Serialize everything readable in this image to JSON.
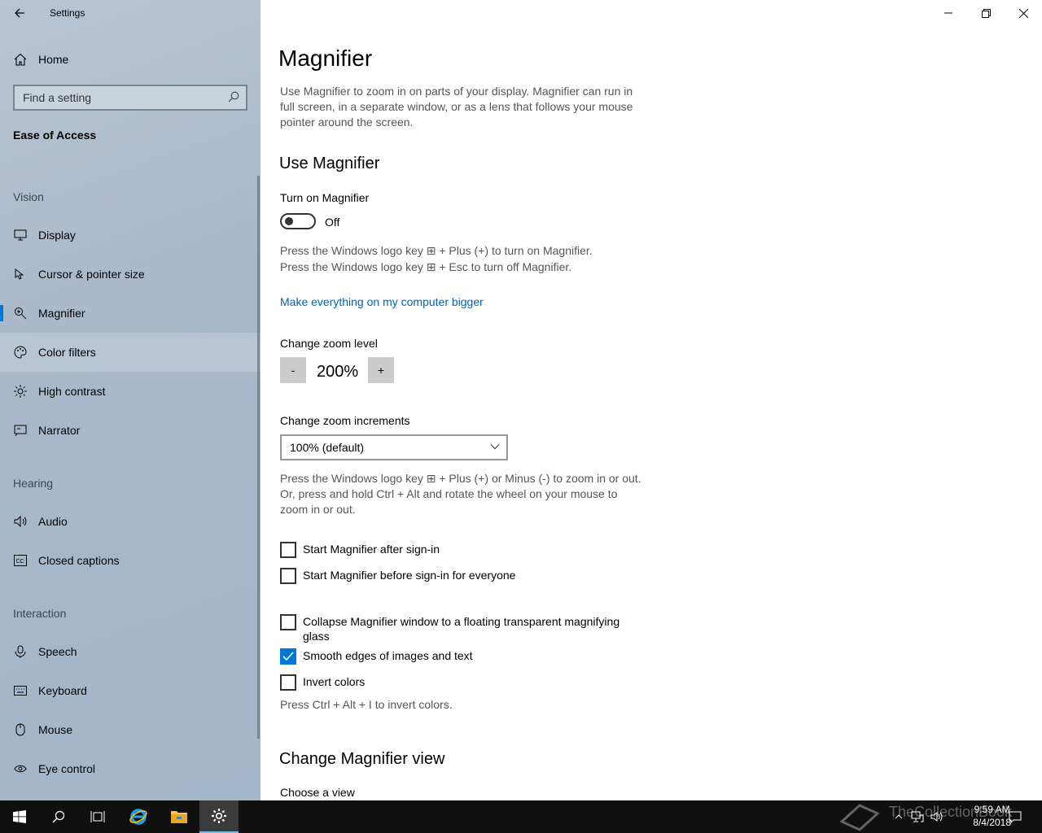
{
  "window": {
    "app_title": "Settings"
  },
  "sidebar": {
    "home_label": "Home",
    "search_placeholder": "Find a setting",
    "section_title": "Ease of Access",
    "groups": {
      "vision": "Vision",
      "hearing": "Hearing",
      "interaction": "Interaction"
    },
    "items": [
      {
        "label": "Display",
        "icon": "monitor-icon"
      },
      {
        "label": "Cursor & pointer size",
        "icon": "cursor-icon"
      },
      {
        "label": "Magnifier",
        "icon": "magnifier-icon",
        "active": true
      },
      {
        "label": "Color filters",
        "icon": "palette-icon"
      },
      {
        "label": "High contrast",
        "icon": "sun-icon"
      },
      {
        "label": "Narrator",
        "icon": "narrator-icon"
      },
      {
        "label": "Audio",
        "icon": "speaker-icon"
      },
      {
        "label": "Closed captions",
        "icon": "cc-icon"
      },
      {
        "label": "Speech",
        "icon": "microphone-icon"
      },
      {
        "label": "Keyboard",
        "icon": "keyboard-icon"
      },
      {
        "label": "Mouse",
        "icon": "mouse-icon"
      },
      {
        "label": "Eye control",
        "icon": "eye-icon"
      }
    ]
  },
  "main": {
    "title": "Magnifier",
    "intro": "Use Magnifier to zoom in on parts of your display. Magnifier can run in full screen, in a separate window, or as a lens that follows your mouse pointer around the screen.",
    "use_heading": "Use Magnifier",
    "turn_on_label": "Turn on Magnifier",
    "toggle_state": "Off",
    "shortcut_on": "Press the Windows logo key ⊞ + Plus (+) to turn on Magnifier.",
    "shortcut_off": "Press the Windows logo key ⊞ + Esc to turn off Magnifier.",
    "bigger_link": "Make everything on my computer bigger",
    "zoom_level_label": "Change zoom level",
    "zoom_minus": "-",
    "zoom_value": "200%",
    "zoom_plus": "+",
    "zoom_increments_label": "Change zoom increments",
    "zoom_increments_value": "100% (default)",
    "zoom_hint": "Press the Windows logo key ⊞ + Plus (+) or Minus (-) to zoom in or out. Or, press and hold Ctrl + Alt and rotate the wheel on your mouse to zoom in or out.",
    "checkboxes": [
      {
        "label": "Start Magnifier after sign-in",
        "checked": false
      },
      {
        "label": "Start Magnifier before sign-in for everyone",
        "checked": false
      },
      {
        "label": "Collapse Magnifier window to a floating transparent magnifying glass",
        "checked": false
      },
      {
        "label": "Smooth edges of images and text",
        "checked": true
      },
      {
        "label": "Invert colors",
        "checked": false
      }
    ],
    "invert_hint": "Press Ctrl + Alt + I to invert colors.",
    "view_heading": "Change Magnifier view",
    "choose_view_label": "Choose a view"
  },
  "taskbar": {
    "time": "9:59 AM",
    "date": "8/4/2018",
    "watermark": "TheCollectionBook"
  },
  "colors": {
    "accent": "#0078d7",
    "link": "#0063b1",
    "taskbar": "#101010"
  }
}
